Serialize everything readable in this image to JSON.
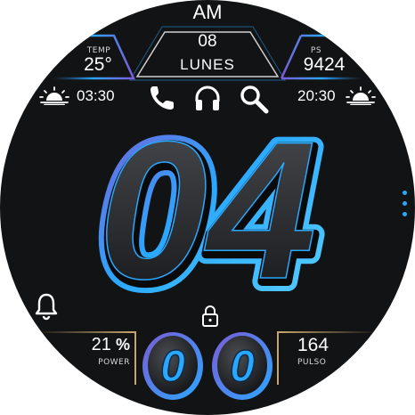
{
  "header": {
    "ampm": "AM",
    "day": "08",
    "weekday": "LUNES"
  },
  "left_top": {
    "label": "TEMP",
    "value": "25°"
  },
  "right_top": {
    "label": "PS",
    "value": "9424"
  },
  "sunrise": {
    "time": "03:30"
  },
  "sunset": {
    "time": "20:30"
  },
  "hours": "04",
  "seconds": {
    "d1": "0",
    "d2": "0"
  },
  "left_bottom": {
    "value": "21",
    "unit": "%",
    "label": "POWER"
  },
  "right_bottom": {
    "value": "164",
    "label": "PULSO"
  },
  "icons": [
    "phone-icon",
    "headphones-icon",
    "search-icon",
    "bell-icon",
    "lock-icon",
    "sunrise-icon",
    "sunset-icon",
    "dots-menu-icon"
  ],
  "colors": {
    "accent_blue": "#2aa8ff",
    "accent_purple": "#7b5bd6",
    "gold": "#c9a56a",
    "bg": "#121314"
  }
}
